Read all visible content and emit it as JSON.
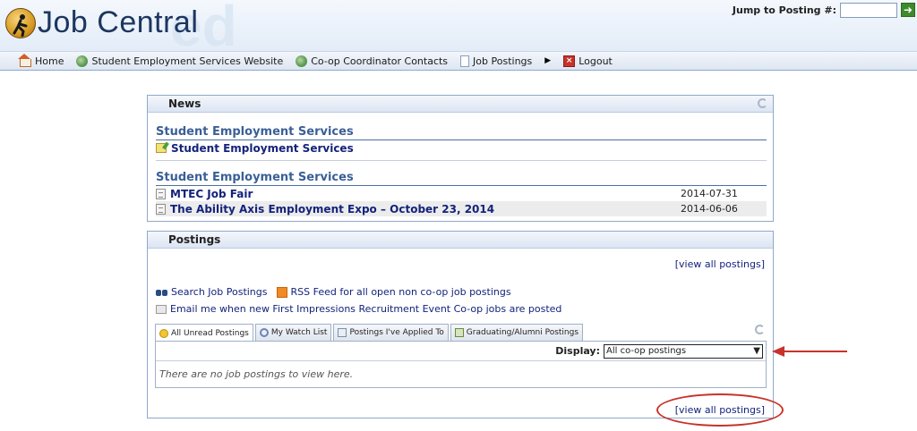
{
  "header": {
    "logo_text": "Job Central",
    "watermark_text": "ed",
    "jump_label": "Jump to Posting #:",
    "jump_value": ""
  },
  "nav": {
    "items": [
      {
        "label": "Home",
        "icon": "home-icon"
      },
      {
        "label": "Student Employment Services Website",
        "icon": "globe-icon"
      },
      {
        "label": "Co-op Coordinator Contacts",
        "icon": "globe-icon"
      },
      {
        "label": "Job Postings",
        "icon": "pages-icon"
      },
      {
        "label": "Logout",
        "icon": "logout-icon"
      }
    ]
  },
  "news": {
    "title": "News",
    "sections": [
      {
        "heading": "Student Employment Services",
        "items": [
          {
            "title": "Student Employment Services",
            "date": ""
          }
        ]
      },
      {
        "heading": "Student Employment Services",
        "items": [
          {
            "title": "MTEC Job Fair",
            "date": "2014-07-31"
          },
          {
            "title": "The Ability Axis Employment Expo – October 23, 2014",
            "date": "2014-06-06"
          }
        ]
      }
    ]
  },
  "postings": {
    "title": "Postings",
    "view_all": "[view all postings]",
    "search_link": "Search Job Postings",
    "rss_link": "RSS Feed for all open non co-op job postings",
    "email_link": "Email me when new First Impressions Recruitment Event Co-op jobs are posted",
    "tabs": [
      "All Unread Postings",
      "My Watch List",
      "Postings I've Applied To",
      "Graduating/Alumni Postings"
    ],
    "display_label": "Display:",
    "display_value": "All co-op postings",
    "empty_message": "There are no job postings to view here."
  },
  "colors": {
    "link": "#13237a",
    "section_heading": "#3a5f96",
    "annotation": "#c8322a"
  }
}
